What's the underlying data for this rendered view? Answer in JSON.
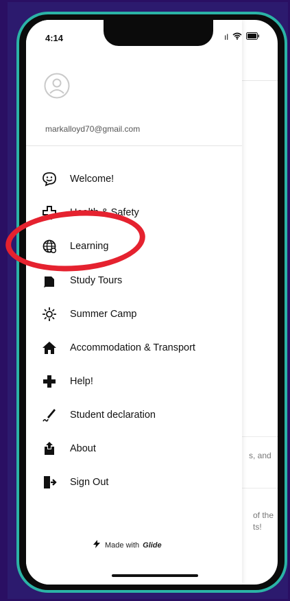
{
  "status_bar": {
    "time": "4:14",
    "signal_text": "ıl",
    "wifi_icon": "wifi-icon",
    "battery_icon": "battery-icon"
  },
  "profile": {
    "email": "markalloyd70@gmail.com",
    "avatar_icon": "user-circle-icon"
  },
  "menu": [
    {
      "label": "Welcome!",
      "icon": "smile-face-icon"
    },
    {
      "label": "Health & Safety",
      "icon": "cross-outline-icon"
    },
    {
      "label": "Learning",
      "icon": "globe-sync-icon"
    },
    {
      "label": "Study Tours",
      "icon": "pencil-book-icon"
    },
    {
      "label": "Summer Camp",
      "icon": "sun-icon"
    },
    {
      "label": "Accommodation & Transport",
      "icon": "home-icon"
    },
    {
      "label": "Help!",
      "icon": "plus-icon"
    },
    {
      "label": "Student declaration",
      "icon": "signature-pen-icon"
    },
    {
      "label": "About",
      "icon": "upload-box-icon"
    },
    {
      "label": "Sign Out",
      "icon": "sign-out-icon"
    }
  ],
  "background_content": {
    "text1": "s, and",
    "text2a": "of the",
    "text2b": "ts!"
  },
  "footer": {
    "prefix": "Made with",
    "brand": "Glide"
  },
  "annotation": {
    "color": "#e5222f",
    "highlighted_item": "Learning"
  }
}
